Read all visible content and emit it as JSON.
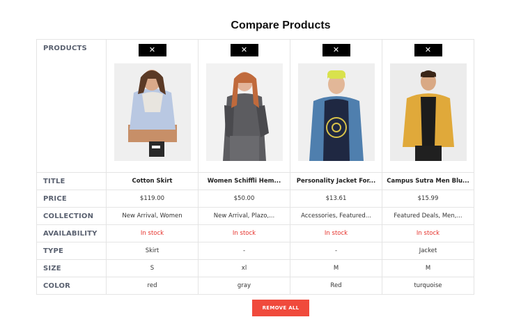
{
  "page": {
    "title": "Compare Products",
    "remove_all_label": "REMOVE ALL",
    "close_glyph": "✕"
  },
  "labels": {
    "products": "PRODUCTS",
    "title": "TITLE",
    "price": "PRICE",
    "collection": "COLLECTION",
    "availability": "AVAILABILITY",
    "type": "TYPE",
    "size": "SIZE",
    "color": "COLOR"
  },
  "products": [
    {
      "title": "Cotton Skirt",
      "price": "$119.00",
      "collection": "New Arrival, Women",
      "availability": "In stock",
      "type": "Skirt",
      "size": "S",
      "color": "red",
      "image_icon": "woman-puffer-jacket-photo"
    },
    {
      "title": "Women Schiffli Hem...",
      "price": "$50.00",
      "collection": "New Arrival, Plazo,...",
      "availability": "In stock",
      "type": "-",
      "size": "xl",
      "color": "gray",
      "image_icon": "woman-gray-knit-photo"
    },
    {
      "title": "Personality Jacket For...",
      "price": "$13.61",
      "collection": "Accessories, Featured...",
      "availability": "In stock",
      "type": "-",
      "size": "M",
      "color": "Red",
      "image_icon": "man-denim-jacket-photo"
    },
    {
      "title": "Campus Sutra Men Blu...",
      "price": "$15.99",
      "collection": "Featured Deals, Men,...",
      "availability": "In stock",
      "type": "Jacket",
      "size": "M",
      "color": "turquoise",
      "image_icon": "man-yellow-puffer-photo"
    }
  ],
  "colors": {
    "stock": "#e5302a",
    "remove_button": "#f04a3c",
    "close_button": "#000000"
  }
}
